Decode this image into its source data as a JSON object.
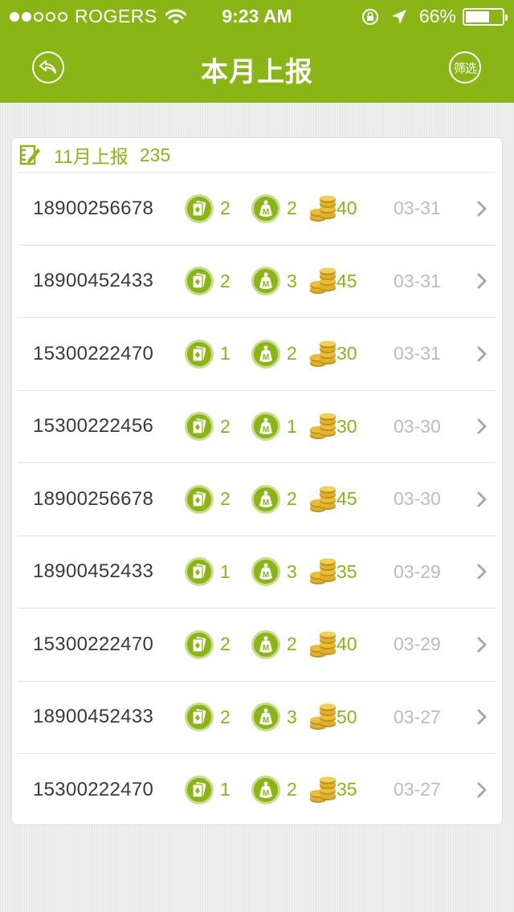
{
  "status_bar": {
    "carrier": "ROGERS",
    "time": "9:23 AM",
    "battery_percent": "66%",
    "battery_level": 0.66,
    "signal_bars_filled": 2,
    "signal_bars_total": 5
  },
  "nav": {
    "title": "本月上报",
    "back_icon": "back-arrow-icon",
    "filter_label": "筛选"
  },
  "summary": {
    "label": "11月上报",
    "count": "235",
    "icon": "edit-report-icon"
  },
  "colors": {
    "accent": "#89b516",
    "date_gray": "#bcbcbc",
    "phone_text": "#3a3a3a",
    "coin_gold": "#e0b22c"
  },
  "columns_icons": [
    "card-icon",
    "member-icon",
    "coins-icon"
  ],
  "rows": [
    {
      "phone": "18900256678",
      "cards": "2",
      "members": "2",
      "coins": "40",
      "date": "03-31"
    },
    {
      "phone": "18900452433",
      "cards": "2",
      "members": "3",
      "coins": "45",
      "date": "03-31"
    },
    {
      "phone": "15300222470",
      "cards": "1",
      "members": "2",
      "coins": "30",
      "date": "03-31"
    },
    {
      "phone": "15300222456",
      "cards": "2",
      "members": "1",
      "coins": "30",
      "date": "03-30"
    },
    {
      "phone": "18900256678",
      "cards": "2",
      "members": "2",
      "coins": "45",
      "date": "03-30"
    },
    {
      "phone": "18900452433",
      "cards": "1",
      "members": "3",
      "coins": "35",
      "date": "03-29"
    },
    {
      "phone": "15300222470",
      "cards": "2",
      "members": "2",
      "coins": "40",
      "date": "03-29"
    },
    {
      "phone": "18900452433",
      "cards": "2",
      "members": "3",
      "coins": "50",
      "date": "03-27"
    },
    {
      "phone": "15300222470",
      "cards": "1",
      "members": "2",
      "coins": "35",
      "date": "03-27"
    }
  ]
}
